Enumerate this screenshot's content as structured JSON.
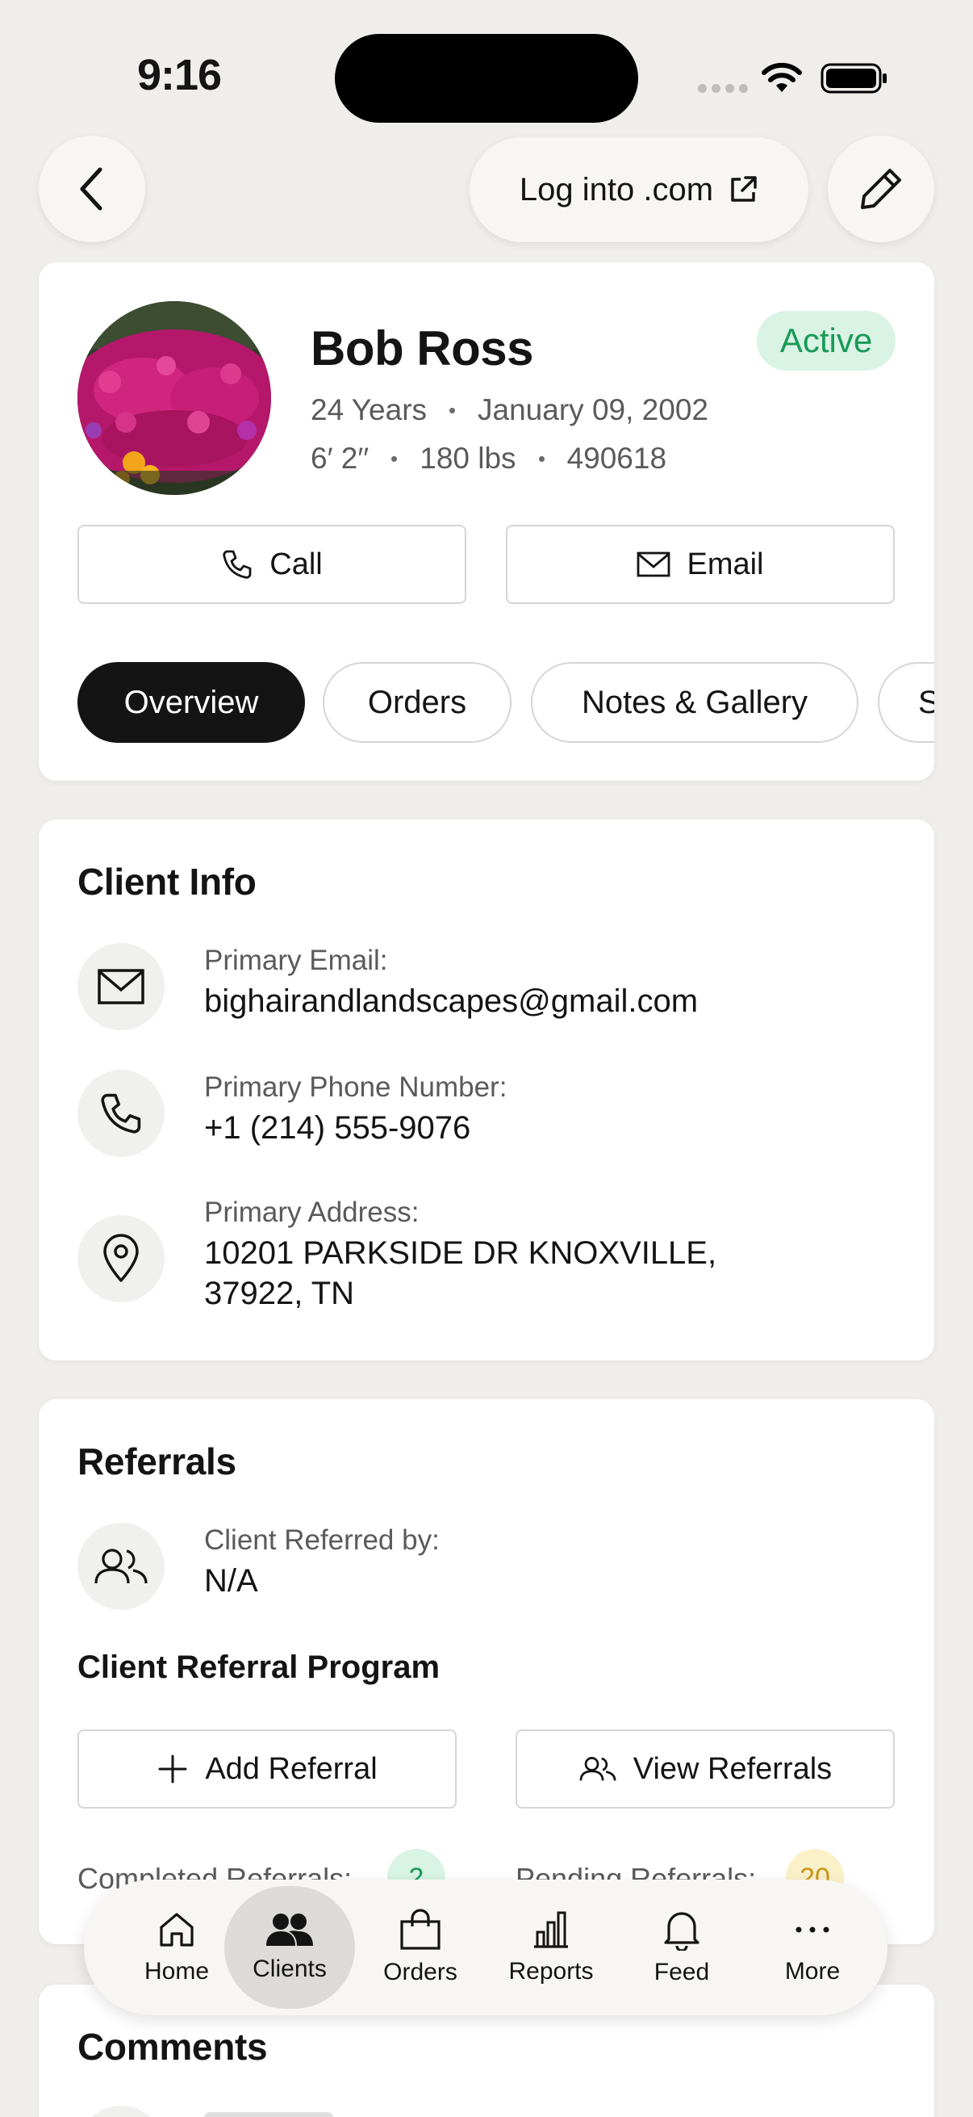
{
  "status_bar": {
    "time": "9:16"
  },
  "top_nav": {
    "login_label": "Log into .com"
  },
  "profile": {
    "name": "Bob Ross",
    "status": "Active",
    "age": "24 Years",
    "birthdate": "January 09, 2002",
    "height": "6′ 2′′",
    "weight": "180 lbs",
    "id": "490618",
    "call_label": "Call",
    "email_label": "Email"
  },
  "tabs": [
    {
      "label": "Overview",
      "active": true
    },
    {
      "label": "Orders",
      "active": false
    },
    {
      "label": "Notes & Gallery",
      "active": false
    },
    {
      "label": "S",
      "active": false
    }
  ],
  "client_info": {
    "title": "Client Info",
    "email_label": "Primary Email:",
    "email_value": "bighairandlandscapes@gmail.com",
    "phone_label": "Primary Phone Number:",
    "phone_value": "+1 (214) 555-9076",
    "address_label": "Primary Address:",
    "address_line1": "10201 PARKSIDE DR KNOXVILLE,",
    "address_line2": "37922, TN"
  },
  "referrals": {
    "title": "Referrals",
    "referred_by_label": "Client Referred by:",
    "referred_by_value": "N/A",
    "program_title": "Client Referral Program",
    "add_label": "Add Referral",
    "view_label": "View Referrals",
    "completed_label": "Completed Referrals:",
    "completed_count": "2",
    "pending_label": "Pending Referrals:",
    "pending_count": "20"
  },
  "comments": {
    "title": "Comments"
  },
  "bottom_nav": [
    {
      "label": "Home",
      "icon": "home-icon"
    },
    {
      "label": "Clients",
      "icon": "users-icon",
      "active": true
    },
    {
      "label": "Orders",
      "icon": "bag-icon"
    },
    {
      "label": "Reports",
      "icon": "bar-chart-icon"
    },
    {
      "label": "Feed",
      "icon": "bell-icon"
    },
    {
      "label": "More",
      "icon": "more-icon"
    }
  ],
  "colors": {
    "background": "#efeeeb",
    "active_badge_bg": "#d9f3e4",
    "active_badge_text": "#1a9a58",
    "tab_active_bg": "#141414",
    "completed_badge_bg": "#d9f3e4",
    "pending_badge_bg": "#fbf1c9"
  }
}
